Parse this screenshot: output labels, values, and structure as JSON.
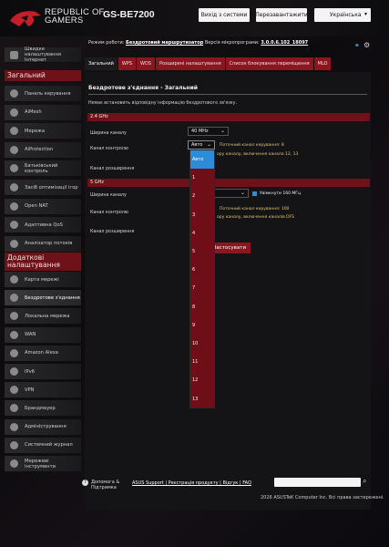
{
  "header": {
    "brand_line1": "REPUBLIC OF",
    "brand_line2": "GAMERS",
    "model": "GS-BE7200",
    "logout_button": "Вихід з системи",
    "reboot_button": "Перезавантажити",
    "language": "Українська"
  },
  "status_bar": {
    "mode_label": "Режим роботи:",
    "mode_value": "Бездротовий маршрутизатор",
    "firmware_label": "Версія мікропрограми:",
    "firmware_value": "3.0.0.6.102_18097"
  },
  "sidebar": {
    "top_item": "Швидке налаштування Інтернет",
    "general_header": "Загальний",
    "general_items": [
      {
        "label": "Панель керування",
        "icon": "dashboard-icon"
      },
      {
        "label": "AiMesh",
        "icon": "aimesh-icon"
      },
      {
        "label": "Мережа",
        "icon": "network-icon"
      },
      {
        "label": "AiProtection",
        "icon": "shield-icon"
      },
      {
        "label": "Батьківський контроль",
        "icon": "parental-control-icon"
      },
      {
        "label": "Засіб оптимізації ігор",
        "icon": "game-boost-icon"
      },
      {
        "label": "Open NAT",
        "icon": "open-nat-icon"
      },
      {
        "label": "Адаптивна QoS",
        "icon": "qos-icon"
      },
      {
        "label": "Аналізатор потоків",
        "icon": "traffic-analyzer-icon"
      }
    ],
    "advanced_header": "Додаткові налаштування",
    "advanced_items": [
      {
        "label": "Карта мережі",
        "icon": "network-map-icon"
      },
      {
        "label": "Бездротове з'єднання",
        "icon": "wireless-icon"
      },
      {
        "label": "Локальна мережа",
        "icon": "lan-icon"
      },
      {
        "label": "WAN",
        "icon": "wan-icon"
      },
      {
        "label": "Amazon Alexa",
        "icon": "alexa-icon"
      },
      {
        "label": "IPv6",
        "icon": "ipv6-icon"
      },
      {
        "label": "VPN",
        "icon": "vpn-icon"
      },
      {
        "label": "Брандмауер",
        "icon": "firewall-icon"
      },
      {
        "label": "Адміністрування",
        "icon": "admin-icon"
      },
      {
        "label": "Системний журнал",
        "icon": "log-icon"
      },
      {
        "label": "Мережеві інструменти",
        "icon": "tools-icon"
      }
    ]
  },
  "tabs": [
    "Загальний",
    "WPS",
    "WDS",
    "Розширені налаштування",
    "Список блокування переміщення",
    "MLO"
  ],
  "panel": {
    "title": "Бездротове з'єднання - Загальний",
    "subtitle": "Немає встановить відповідну інформацію бездротового зв'язку.",
    "band_24": "2.4 GHz",
    "band_5": "5 GHz",
    "bandwidth_label": "Ширина каналу",
    "control_channel_label": "Канал контролю",
    "extension_channel_label": "Канал розширення",
    "bw24_value": "40 MHz",
    "cc24_value": "Авто",
    "note_current_24": "Поточний канал керування: 8",
    "note_auto_24": "ору каналу, включення канала 12, 13",
    "enable_160": "Увімкнути 160 МГц",
    "note_current_5": "Поточний канал керування: 100",
    "note_auto_5": "ору каналу, включення каналів DFS",
    "apply_button": "Застосувати"
  },
  "channel_dropdown": {
    "options": [
      "Авто",
      "1",
      "2",
      "3",
      "4",
      "5",
      "6",
      "7",
      "8",
      "9",
      "10",
      "11",
      "12",
      "13"
    ],
    "selected_index": 0
  },
  "footer": {
    "help_line1": "Допомога &",
    "help_line2": "Підтримка",
    "links": "ASUS Support | Реєстрація продукту | Відгук | FAQ",
    "copyright": "2026 ASUSTeK Computer Inc. Всі права застережені."
  },
  "colors": {
    "accent": "#8c1620",
    "band": "#6e1118",
    "selected": "#2e8bd6"
  }
}
